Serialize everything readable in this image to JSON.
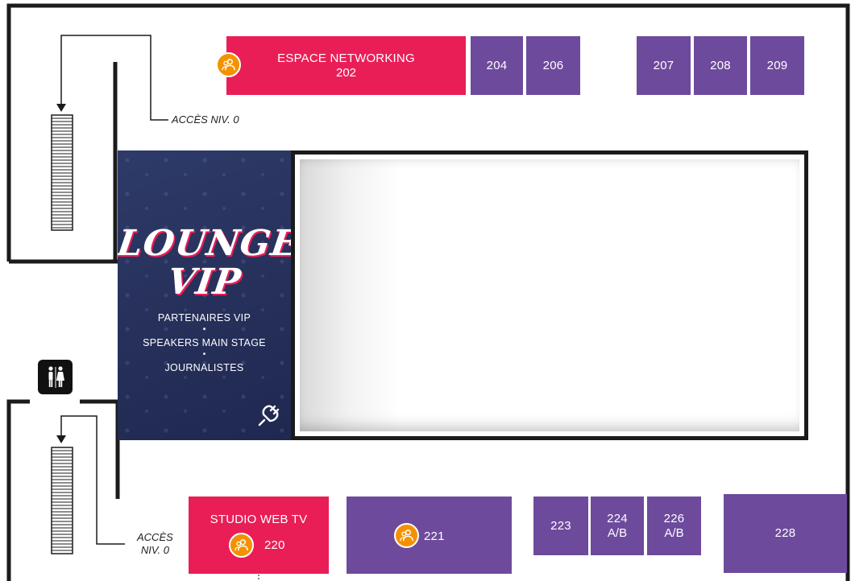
{
  "rooms": {
    "r202": {
      "name": "ESPACE NETWORKING",
      "number": "202",
      "color": "#e91e57"
    },
    "r204": {
      "number": "204"
    },
    "r206": {
      "number": "206"
    },
    "r207": {
      "number": "207"
    },
    "r208": {
      "number": "208"
    },
    "r209": {
      "number": "209"
    },
    "r220": {
      "name": "STUDIO WEB TV",
      "number": "220",
      "color": "#e91e57"
    },
    "r221": {
      "number": "221"
    },
    "r223": {
      "number": "223"
    },
    "r224": {
      "number": "224",
      "suffix": "A/B"
    },
    "r226": {
      "number": "226",
      "suffix": "A/B"
    },
    "r228": {
      "number": "228"
    }
  },
  "access": {
    "top": "ACCÈS NIV. 0",
    "bottom_line1": "ACCÈS",
    "bottom_line2": "NIV. 0"
  },
  "lounge": {
    "title_line1": "LOUNGE",
    "title_line2": "VIP",
    "audience": [
      "PARTENAIRES VIP",
      "SPEAKERS MAIN STAGE",
      "JOURNALISTES"
    ],
    "separator": "•",
    "icon": "power-plug-icon"
  },
  "icons": {
    "meeting": "people-group-icon",
    "restroom": "restroom-icon",
    "stairs": "staircase-icon"
  },
  "colors": {
    "pink": "#e91e57",
    "purple": "#6e4a9c",
    "badge": "#f39200",
    "lounge": "#2b3563",
    "walls": "#1b1b1b"
  }
}
